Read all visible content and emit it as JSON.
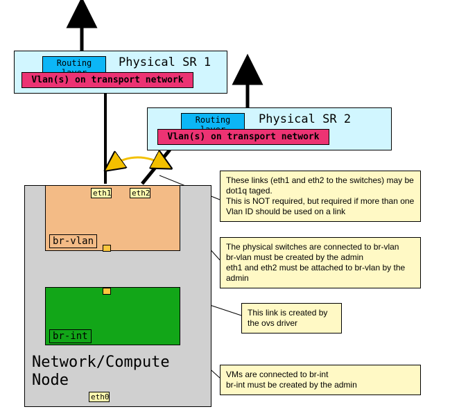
{
  "sr1": {
    "label": "Physical SR 1",
    "routing": "Routing layer",
    "vlan": "Vlan(s) on transport network"
  },
  "sr2": {
    "label": "Physical SR 2",
    "routing": "Routing layer",
    "vlan": "Vlan(s) on transport network"
  },
  "node": {
    "label": "Network/Compute\nNode",
    "br_vlan": "br-vlan",
    "br_int": "br-int",
    "eth0": "eth0",
    "eth1": "eth1",
    "eth2": "eth2"
  },
  "notes": {
    "links_tagged": "These links (eth1 and eth2 to the switches) may be dot1q taged.\nThis is NOT required, but required if more than one Vlan ID should be used on a link",
    "switches_brvlan": "The physical switches are connected to br-vlan\nbr-vlan must be created by the admin\neth1 and eth2 must be attached to br-vlan by the admin",
    "ovs_link": "This link is created by the ovs driver",
    "vms_brint": "VMs are connected to br-int\nbr-int must be created by the admin"
  }
}
